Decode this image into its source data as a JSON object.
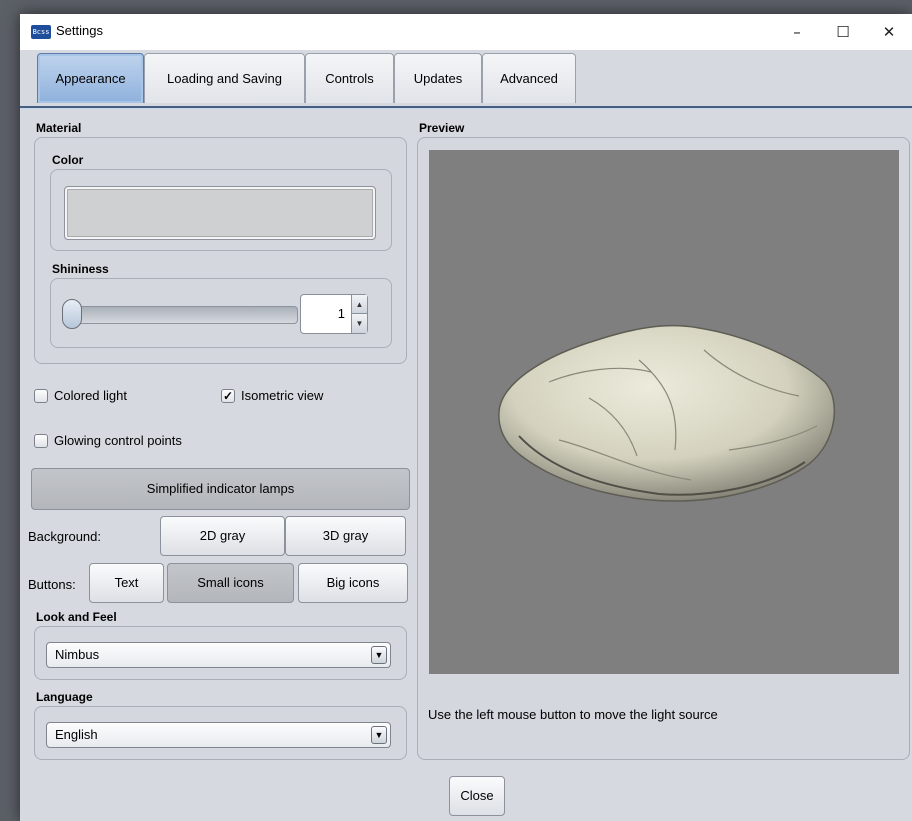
{
  "window": {
    "title": "Settings",
    "app_icon_text": "Bcss",
    "controls": {
      "minimize": "–",
      "maximize": "☐",
      "close": "✕"
    }
  },
  "tabs": [
    {
      "label": "Appearance",
      "active": true
    },
    {
      "label": "Loading and Saving",
      "active": false
    },
    {
      "label": "Controls",
      "active": false
    },
    {
      "label": "Updates",
      "active": false
    },
    {
      "label": "Advanced",
      "active": false
    }
  ],
  "material": {
    "label": "Material",
    "color_label": "Color",
    "color_value": "#cfd0d1",
    "shininess_label": "Shininess",
    "shininess_value": "1"
  },
  "checkboxes": {
    "colored_light": {
      "label": "Colored light",
      "checked": false
    },
    "isometric_view": {
      "label": "Isometric view",
      "checked": true
    },
    "glowing_points": {
      "label": "Glowing control points",
      "checked": false
    }
  },
  "check_mark": "✓",
  "indicator_button": "Simplified indicator lamps",
  "background": {
    "label": "Background:",
    "options": [
      "2D gray",
      "3D gray"
    ]
  },
  "buttons_row": {
    "label": "Buttons:",
    "options": [
      "Text",
      "Small icons",
      "Big icons"
    ],
    "selected": "Small icons"
  },
  "look_and_feel": {
    "label": "Look and Feel",
    "value": "Nimbus"
  },
  "language": {
    "label": "Language",
    "value": "English"
  },
  "combo_arrow": "▼",
  "spin_up": "▲",
  "spin_down": "▼",
  "preview": {
    "label": "Preview",
    "background": "#7f7f7f",
    "object_color": "#dcdac6",
    "hint": "Use the left mouse button to move the light source"
  },
  "close_button": "Close"
}
